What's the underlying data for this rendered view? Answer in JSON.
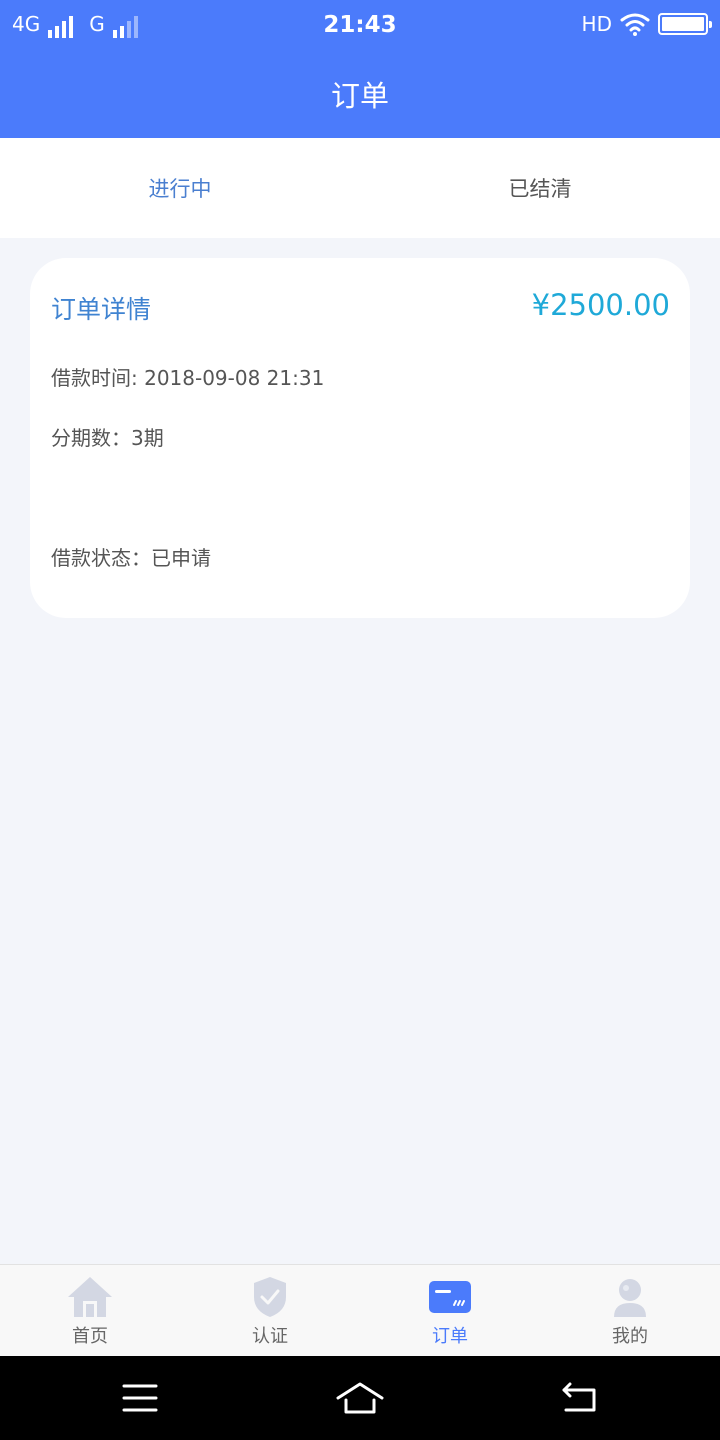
{
  "status_bar": {
    "network_1": "4G",
    "network_2": "G",
    "time": "21:43",
    "hd": "HD"
  },
  "app_bar": {
    "title": "订单"
  },
  "tabs": [
    {
      "label": "进行中",
      "active": true
    },
    {
      "label": "已结清",
      "active": false
    }
  ],
  "order_card": {
    "title": "订单详情",
    "amount": "¥2500.00",
    "loan_time": "借款时间: 2018-09-08 21:31",
    "installments": "分期数：3期",
    "status": "借款状态：已申请"
  },
  "bottom_nav": {
    "items": [
      {
        "label": "首页",
        "icon": "home-icon"
      },
      {
        "label": "认证",
        "icon": "shield-check-icon"
      },
      {
        "label": "订单",
        "icon": "card-icon"
      },
      {
        "label": "我的",
        "icon": "user-icon"
      }
    ]
  },
  "colors": {
    "primary": "#4b7bfb",
    "tab_active": "#4a7fd0",
    "amount": "#1fa9d8",
    "inactive_icon": "#d3d7e3",
    "background": "#f3f5fa"
  }
}
